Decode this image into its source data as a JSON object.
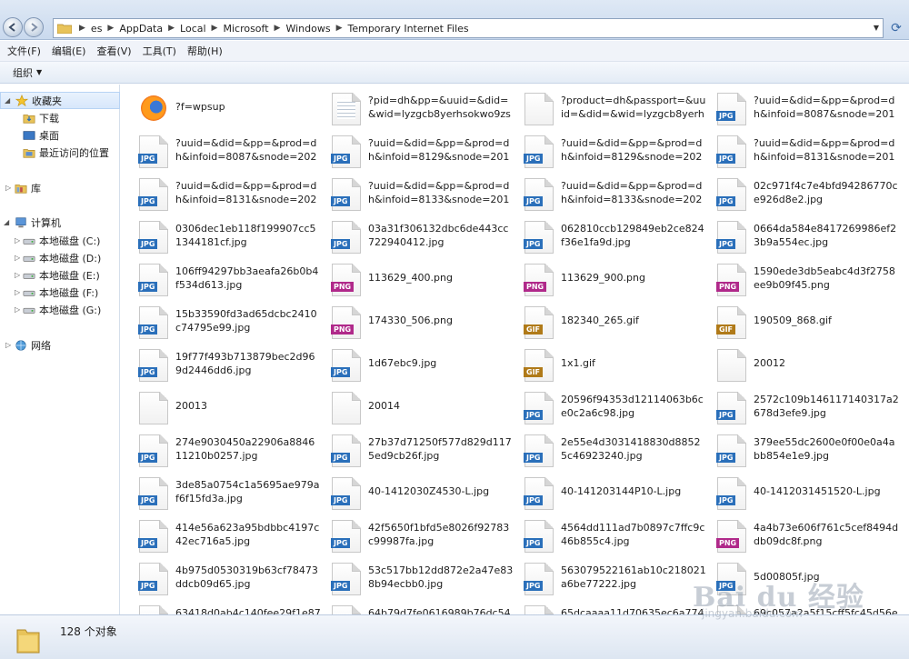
{
  "address": {
    "crumbs": [
      "es",
      "AppData",
      "Local",
      "Microsoft",
      "Windows",
      "Temporary Internet Files"
    ]
  },
  "menu": [
    "文件(F)",
    "编辑(E)",
    "查看(V)",
    "工具(T)",
    "帮助(H)"
  ],
  "command_bar": {
    "organize": "组织"
  },
  "nav": {
    "favorites": "收藏夹",
    "downloads": "下载",
    "desktop": "桌面",
    "recent": "最近访问的位置",
    "libraries": "库",
    "computer": "计算机",
    "drives": [
      "本地磁盘 (C:)",
      "本地磁盘 (D:)",
      "本地磁盘 (E:)",
      "本地磁盘 (F:)",
      "本地磁盘 (G:)"
    ],
    "network": "网络"
  },
  "files": [
    {
      "name": "?f=wpsup",
      "type": "firefox"
    },
    {
      "name": "?pid=dh&pp=&uuid=&did=&wid=lyzgcb8yerhsokwo9zsfx2oc...",
      "type": "doc"
    },
    {
      "name": "?product=dh&passport=&uuid=&did=&wid=lyzgcb8yerhsok...",
      "type": "blank"
    },
    {
      "name": "?uuid=&did=&pp=&prod=dh&infoid=8087&snode=201&dur...",
      "type": "JPG"
    },
    {
      "name": "?uuid=&did=&pp=&prod=dh&infoid=8087&snode=202&dur...",
      "type": "JPG"
    },
    {
      "name": "?uuid=&did=&pp=&prod=dh&infoid=8129&snode=201&dur...",
      "type": "JPG"
    },
    {
      "name": "?uuid=&did=&pp=&prod=dh&infoid=8129&snode=202&dur...",
      "type": "JPG"
    },
    {
      "name": "?uuid=&did=&pp=&prod=dh&infoid=8131&snode=201&dur...",
      "type": "JPG"
    },
    {
      "name": "?uuid=&did=&pp=&prod=dh&infoid=8131&snode=202&dur...",
      "type": "JPG"
    },
    {
      "name": "?uuid=&did=&pp=&prod=dh&infoid=8133&snode=201&dur...",
      "type": "JPG"
    },
    {
      "name": "?uuid=&did=&pp=&prod=dh&infoid=8133&snode=202&dur...",
      "type": "JPG"
    },
    {
      "name": "02c971f4c7e4bfd94286770ce926d8e2.jpg",
      "type": "JPG"
    },
    {
      "name": "0306dec1eb118f199907cc51344181cf.jpg",
      "type": "JPG"
    },
    {
      "name": "03a31f306132dbc6de443cc722940412.jpg",
      "type": "JPG"
    },
    {
      "name": "062810ccb129849eb2ce824f36e1fa9d.jpg",
      "type": "JPG"
    },
    {
      "name": "0664da584e8417269986ef23b9a554ec.jpg",
      "type": "JPG"
    },
    {
      "name": "106ff94297bb3aeafa26b0b4f534d613.jpg",
      "type": "JPG"
    },
    {
      "name": "113629_400.png",
      "type": "PNG"
    },
    {
      "name": "113629_900.png",
      "type": "PNG"
    },
    {
      "name": "1590ede3db5eabc4d3f2758ee9b09f45.png",
      "type": "PNG"
    },
    {
      "name": "15b33590fd3ad65dcbc2410c74795e99.jpg",
      "type": "JPG"
    },
    {
      "name": "174330_506.png",
      "type": "PNG"
    },
    {
      "name": "182340_265.gif",
      "type": "GIF"
    },
    {
      "name": "190509_868.gif",
      "type": "GIF"
    },
    {
      "name": "19f77f493b713879bec2d969d2446dd6.jpg",
      "type": "JPG"
    },
    {
      "name": "1d67ebc9.jpg",
      "type": "JPG"
    },
    {
      "name": "1x1.gif",
      "type": "GIF"
    },
    {
      "name": "20012",
      "type": "blank"
    },
    {
      "name": "20013",
      "type": "blank"
    },
    {
      "name": "20014",
      "type": "blank"
    },
    {
      "name": "20596f94353d12114063b6ce0c2a6c98.jpg",
      "type": "JPG"
    },
    {
      "name": "2572c109b146117140317a2678d3efe9.jpg",
      "type": "JPG"
    },
    {
      "name": "274e9030450a22906a884611210b0257.jpg",
      "type": "JPG"
    },
    {
      "name": "27b37d71250f577d829d1175ed9cb26f.jpg",
      "type": "JPG"
    },
    {
      "name": "2e55e4d3031418830d88525c46923240.jpg",
      "type": "JPG"
    },
    {
      "name": "379ee55dc2600e0f00e0a4abb854e1e9.jpg",
      "type": "JPG"
    },
    {
      "name": "3de85a0754c1a5695ae979af6f15fd3a.jpg",
      "type": "JPG"
    },
    {
      "name": "40-1412030Z4530-L.jpg",
      "type": "JPG"
    },
    {
      "name": "40-141203144P10-L.jpg",
      "type": "JPG"
    },
    {
      "name": "40-1412031451520-L.jpg",
      "type": "JPG"
    },
    {
      "name": "414e56a623a95bdbbc4197c42ec716a5.jpg",
      "type": "JPG"
    },
    {
      "name": "42f5650f1bfd5e8026f92783c99987fa.jpg",
      "type": "JPG"
    },
    {
      "name": "4564dd111ad7b0897c7ffc9c46b855c4.jpg",
      "type": "JPG"
    },
    {
      "name": "4a4b73e606f761c5cef8494ddb09dc8f.png",
      "type": "PNG"
    },
    {
      "name": "4b975d0530319b63cf78473ddcb09d65.jpg",
      "type": "JPG"
    },
    {
      "name": "53c517bb12dd872e2a47e838b94ecbb0.jpg",
      "type": "JPG"
    },
    {
      "name": "563079522161ab10c218021a6be77222.jpg",
      "type": "JPG"
    },
    {
      "name": "5d00805f.jpg",
      "type": "JPG"
    },
    {
      "name": "63418d0ab4c140fee29f1e8722e",
      "type": "JPG"
    },
    {
      "name": "64b79d7fe0616989b76dc54d31",
      "type": "JPG"
    },
    {
      "name": "65dcaaaa11d70635ec6a774c8d",
      "type": "JPG"
    },
    {
      "name": "69c057a2a5f15cff5fc45d56eb41",
      "type": "JPG"
    }
  ],
  "badge_colors": {
    "JPG": "#2a6fba",
    "PNG": "#b0298a",
    "GIF": "#b07a18"
  },
  "status": {
    "count": "128 个对象"
  },
  "watermark": {
    "logo": "Bai du 经验",
    "url": "jingyan.baidu.com"
  }
}
